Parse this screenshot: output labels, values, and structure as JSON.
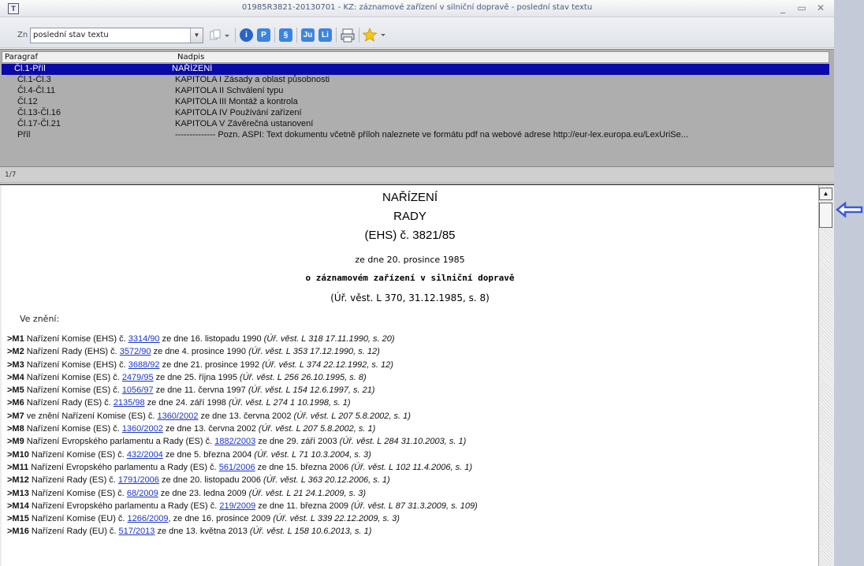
{
  "window": {
    "title": "01985R3821-20130701 - KZ: záznamové zařízení v silniční dopravě - poslední stav textu",
    "app_icon_letter": "T"
  },
  "toolbar": {
    "zn_label": "Zn",
    "version_value": "poslední stav textu",
    "icons": [
      "copy-dropdown-icon",
      "info-icon",
      "p-icon",
      "section-icon",
      "ju-icon",
      "li-icon",
      "print-icon",
      "star-icon"
    ],
    "p_label": "P",
    "section_label": "§",
    "ju_label": "Ju",
    "li_label": "Li",
    "info_label": "i"
  },
  "paragraphs": {
    "header_col1": "Paragraf",
    "header_col2": "Nadpis",
    "count": "1/7",
    "rows": [
      {
        "para": "Čl.1-Příl",
        "title": "NAŘÍZENÍ"
      },
      {
        "para": "Čl.1-Čl.3",
        "title": "KAPITOLA I Zásady a oblast působnosti"
      },
      {
        "para": "Čl.4-Čl.11",
        "title": "KAPITOLA II Schválení typu"
      },
      {
        "para": "Čl.12",
        "title": "KAPITOLA III Montáž a kontrola"
      },
      {
        "para": "Čl.13-Čl.16",
        "title": "KAPITOLA IV Používání zařízení"
      },
      {
        "para": "Čl.17-Čl.21",
        "title": "KAPITOLA V Závěrečná ustanovení"
      },
      {
        "para": "Příl",
        "title": "-------------- Pozn. ASPI: Text dokumentu včetně příloh naleznete ve formátu pdf na webové adrese http://eur-lex.europa.eu/LexUriSe..."
      }
    ]
  },
  "document": {
    "title1": "NAŘÍZENÍ",
    "title2": "RADY",
    "title3": "(EHS) č. 3821/85",
    "date": "ze dne 20. prosince 1985",
    "subject": "o záznamovém zařízení v silniční dopravě",
    "reference": "(Úř. věst. L 370, 31.12.1985, s. 8)",
    "amended_label": "Ve znění:",
    "amendments": [
      {
        "code": ">M1",
        "pre": " Nařízení Komise (EHS) č. ",
        "link": "3314/90",
        "post": " ze dne 16. listopadu 1990 ",
        "ref": "(Úř. věst. L 318 17.11.1990, s. 20)"
      },
      {
        "code": ">M2",
        "pre": " Nařízení Rady (EHS) č. ",
        "link": "3572/90",
        "post": " ze dne 4. prosince 1990 ",
        "ref": "(Úř. věst. L 353 17.12.1990, s. 12)"
      },
      {
        "code": ">M3",
        "pre": " Nařízení Komise (EHS) č. ",
        "link": "3688/92",
        "post": " ze dne 21. prosince 1992 ",
        "ref": "(Úř. věst. L 374 22.12.1992, s. 12)"
      },
      {
        "code": ">M4",
        "pre": " Nařízení Komise (ES) č. ",
        "link": "2479/95",
        "post": " ze dne 25. října 1995 ",
        "ref": "(Úř. věst. L 256 26.10.1995, s. 8)"
      },
      {
        "code": ">M5",
        "pre": " Nařízení Komise (ES) č. ",
        "link": "1056/97",
        "post": " ze dne 11. června 1997 ",
        "ref": "(Úř. věst. L 154 12.6.1997, s. 21)"
      },
      {
        "code": ">M6",
        "pre": " Nařízení Rady (ES) č. ",
        "link": "2135/98",
        "post": " ze dne 24. září 1998 ",
        "ref": "(Úř. věst. L 274 1 10.1998, s. 1)"
      },
      {
        "code": ">M7",
        "pre": " ve znění Nařízení Komise (ES) č. ",
        "link": "1360/2002",
        "post": " ze dne 13. června 2002 ",
        "ref": "(Úř. věst. L 207 5.8.2002, s. 1)"
      },
      {
        "code": ">M8",
        "pre": " Nařízení Komise (ES) č. ",
        "link": "1360/2002",
        "post": " ze dne 13. června 2002 ",
        "ref": "(Úř. věst. L 207 5.8.2002, s. 1)"
      },
      {
        "code": ">M9",
        "pre": " Nařízení Evropského parlamentu a Rady (ES) č. ",
        "link": "1882/2003",
        "post": " ze dne 29. září 2003 ",
        "ref": "(Úř. věst. L 284 31.10.2003, s. 1)"
      },
      {
        "code": ">M10",
        "pre": " Nařízení Komise (ES) č. ",
        "link": "432/2004",
        "post": " ze dne 5. března 2004 ",
        "ref": "(Úř. věst. L 71 10.3.2004, s. 3)"
      },
      {
        "code": ">M11",
        "pre": " Nařízení Evropského parlamentu a Rady (ES) č. ",
        "link": "561/2006",
        "post": " ze dne 15. března 2006 ",
        "ref": "(Úř. věst. L 102 11.4.2006, s. 1)"
      },
      {
        "code": ">M12",
        "pre": " Nařízení Rady (ES) č. ",
        "link": "1791/2006",
        "post": " ze dne 20. listopadu 2006 ",
        "ref": "(Úř. věst. L 363 20.12.2006, s. 1)"
      },
      {
        "code": ">M13",
        "pre": " Nařízení Komise (ES) č. ",
        "link": "68/2009",
        "post": " ze dne 23. ledna 2009 ",
        "ref": "(Úř. věst. L 21 24.1.2009, s. 3)"
      },
      {
        "code": ">M14",
        "pre": " Nařízení Evropského parlamentu a Rady (ES) č. ",
        "link": "219/2009",
        "post": " ze dne 11. března 2009 ",
        "ref": "(Úř. věst. L 87 31.3.2009, s. 109)"
      },
      {
        "code": ">M15",
        "pre": " Nařízení Komise (EU) č. ",
        "link": "1266/2009",
        "post": ", ze dne 16. prosince 2009 ",
        "ref": "(Úř. věst. L 339 22.12.2009, s. 3)"
      },
      {
        "code": ">M16",
        "pre": " Nařízení Rady (EU) č. ",
        "link": "517/2013",
        "post": " ze dne 13. května 2013 ",
        "ref": "(Úř. věst. L 158 10.6.2013, s. 1)"
      }
    ]
  },
  "colors": {
    "selection": "#0a0aa8",
    "link": "#1a35c8",
    "side_arrow": "#3a5bd6"
  }
}
